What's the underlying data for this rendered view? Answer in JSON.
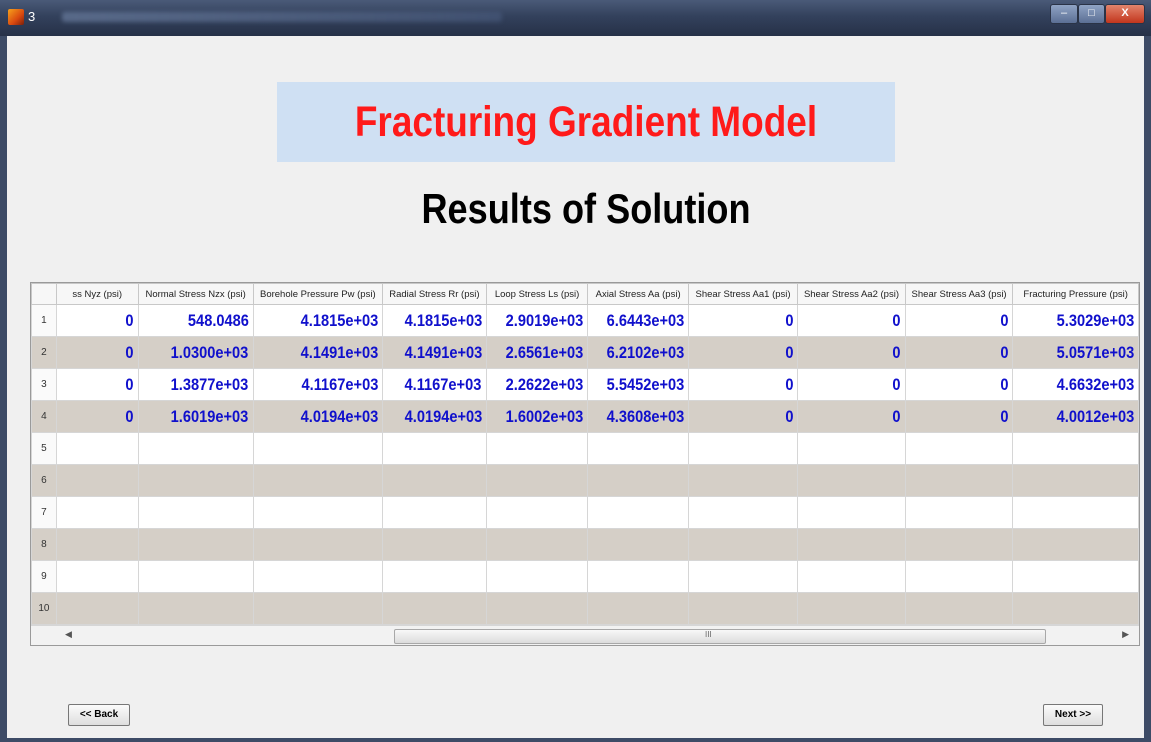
{
  "window": {
    "title": "3",
    "close_label": "X"
  },
  "header": {
    "title": "Fracturing Gradient Model",
    "subtitle": "Results of Solution"
  },
  "table": {
    "columns": [
      "ss Nyz (psi)",
      "Normal Stress Nzx (psi)",
      "Borehole Pressure Pw (psi)",
      "Radial Stress Rr (psi)",
      "Loop Stress Ls (psi)",
      "Axial Stress Aa (psi)",
      "Shear Stress Aa1 (psi)",
      "Shear Stress Aa2 (psi)",
      "Shear Stress Aa3 (psi)",
      "Fracturing Pressure (psi)"
    ],
    "row_numbers": [
      "1",
      "2",
      "3",
      "4",
      "5",
      "6",
      "7",
      "8",
      "9",
      "10"
    ],
    "rows": [
      [
        "0",
        "548.0486",
        "4.1815e+03",
        "4.1815e+03",
        "2.9019e+03",
        "6.6443e+03",
        "0",
        "0",
        "0",
        "5.3029e+03"
      ],
      [
        "0",
        "1.0300e+03",
        "4.1491e+03",
        "4.1491e+03",
        "2.6561e+03",
        "6.2102e+03",
        "0",
        "0",
        "0",
        "5.0571e+03"
      ],
      [
        "0",
        "1.3877e+03",
        "4.1167e+03",
        "4.1167e+03",
        "2.2622e+03",
        "5.5452e+03",
        "0",
        "0",
        "0",
        "4.6632e+03"
      ],
      [
        "0",
        "1.6019e+03",
        "4.0194e+03",
        "4.0194e+03",
        "1.6002e+03",
        "4.3608e+03",
        "0",
        "0",
        "0",
        "4.0012e+03"
      ]
    ],
    "scroll_grip": "III"
  },
  "buttons": {
    "back": "<< Back",
    "next": "Next >>"
  },
  "colors": {
    "title": "#ff1a1a",
    "title_bg": "#cfe0f3",
    "cell_value": "#1010cc",
    "stripe": "#d5cfc7"
  }
}
